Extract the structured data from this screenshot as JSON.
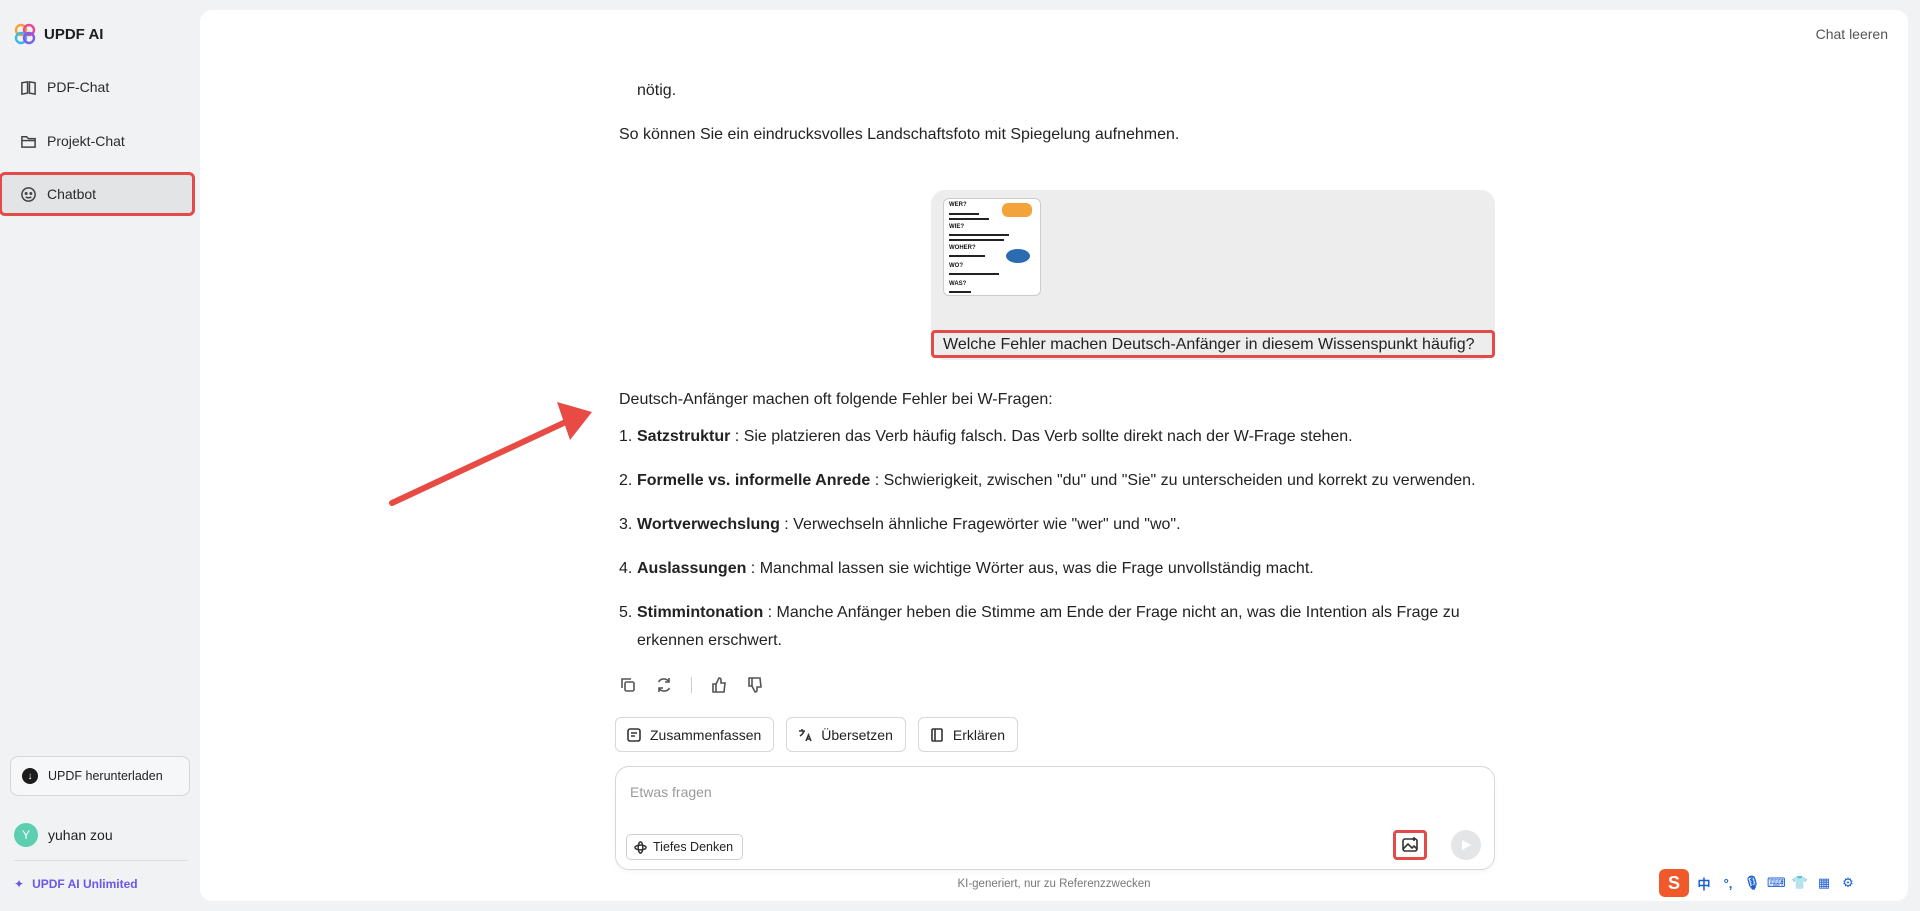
{
  "sidebar": {
    "brand": "UPDF AI",
    "nav": [
      {
        "label": "PDF-Chat",
        "icon": "book-icon"
      },
      {
        "label": "Projekt-Chat",
        "icon": "folder-icon"
      },
      {
        "label": "Chatbot",
        "icon": "bot-icon"
      }
    ],
    "download_label": "UPDF herunterladen",
    "user": {
      "initial": "Y",
      "name": "yuhan zou"
    },
    "unlimited_label": "UPDF AI Unlimited"
  },
  "header": {
    "clear_chat": "Chat leeren"
  },
  "chat": {
    "prev_tail": "nötig.",
    "prev_closing": "So können Sie ein eindrucksvolles Landschaftsfoto mit Spiegelung aufnehmen.",
    "user_question": "Welche Fehler machen Deutsch-Anfänger in diesem Wissenspunkt häufig?",
    "thumb_heads": [
      "WER?",
      "WIE?",
      "WOHER?",
      "WO?",
      "WAS?"
    ],
    "answer": {
      "intro": "Deutsch-Anfänger machen oft folgende Fehler bei W-Fragen:",
      "items": [
        {
          "num": "1.",
          "term": "Satzstruktur",
          "text": " : Sie platzieren das Verb häufig falsch. Das Verb sollte direkt nach der W-Frage stehen."
        },
        {
          "num": "2.",
          "term": "Formelle vs. informelle Anrede",
          "text": " : Schwierigkeit, zwischen \"du\" und \"Sie\" zu unterscheiden und korrekt zu verwenden."
        },
        {
          "num": "3.",
          "term": "Wortverwechslung",
          "text": " : Verwechseln ähnliche Fragewörter wie \"wer\" und \"wo\"."
        },
        {
          "num": "4.",
          "term": "Auslassungen",
          "text": " : Manchmal lassen sie wichtige Wörter aus, was die Frage unvollständig macht."
        },
        {
          "num": "5.",
          "term": "Stimmintonation",
          "text": " : Manche Anfänger heben die Stimme am Ende der Frage nicht an, was die Intention als Frage zu erkennen erschwert."
        }
      ]
    }
  },
  "quick_actions": [
    "Zusammenfassen",
    "Übersetzen",
    "Erklären"
  ],
  "composer": {
    "placeholder": "Etwas fragen",
    "deep_think_label": "Tiefes Denken"
  },
  "disclaimer": "KI-generiert, nur zu Referenzzwecken",
  "ime": {
    "logo": "S",
    "lang": "中",
    "punct": "°,"
  },
  "colors": {
    "highlight": "#e34a4a",
    "accent": "#6b56e8",
    "avatar": "#5ccfb0"
  }
}
